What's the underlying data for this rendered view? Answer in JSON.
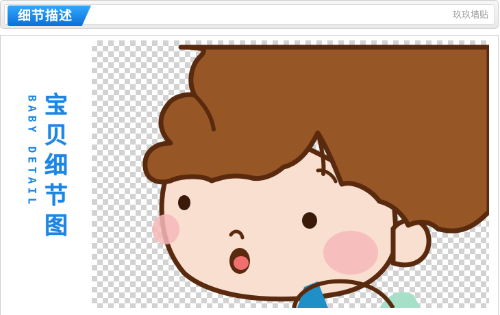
{
  "header": {
    "title": "细节描述",
    "brand": "玖玖墙贴"
  },
  "side_label": {
    "chinese": [
      "宝",
      "贝",
      "细",
      "节",
      "图"
    ],
    "english": [
      "B",
      "A",
      "B",
      "Y",
      " ",
      "D",
      "E",
      "T",
      "A",
      "I",
      "L"
    ]
  },
  "illustration": {
    "subject": "cartoon-boy-face",
    "colors": {
      "hair": "#975626",
      "outline": "#5a2a0e",
      "skin": "#f8dfd0",
      "cheek": "#f6b8b8",
      "mouth": "#f07070",
      "accent_blue": "#1f8fc8",
      "accent_mint": "#a6e0c9"
    }
  },
  "colors": {
    "accent": "#1a86e6",
    "tab_top": "#33a8ff",
    "tab_bottom": "#0a70d8"
  }
}
